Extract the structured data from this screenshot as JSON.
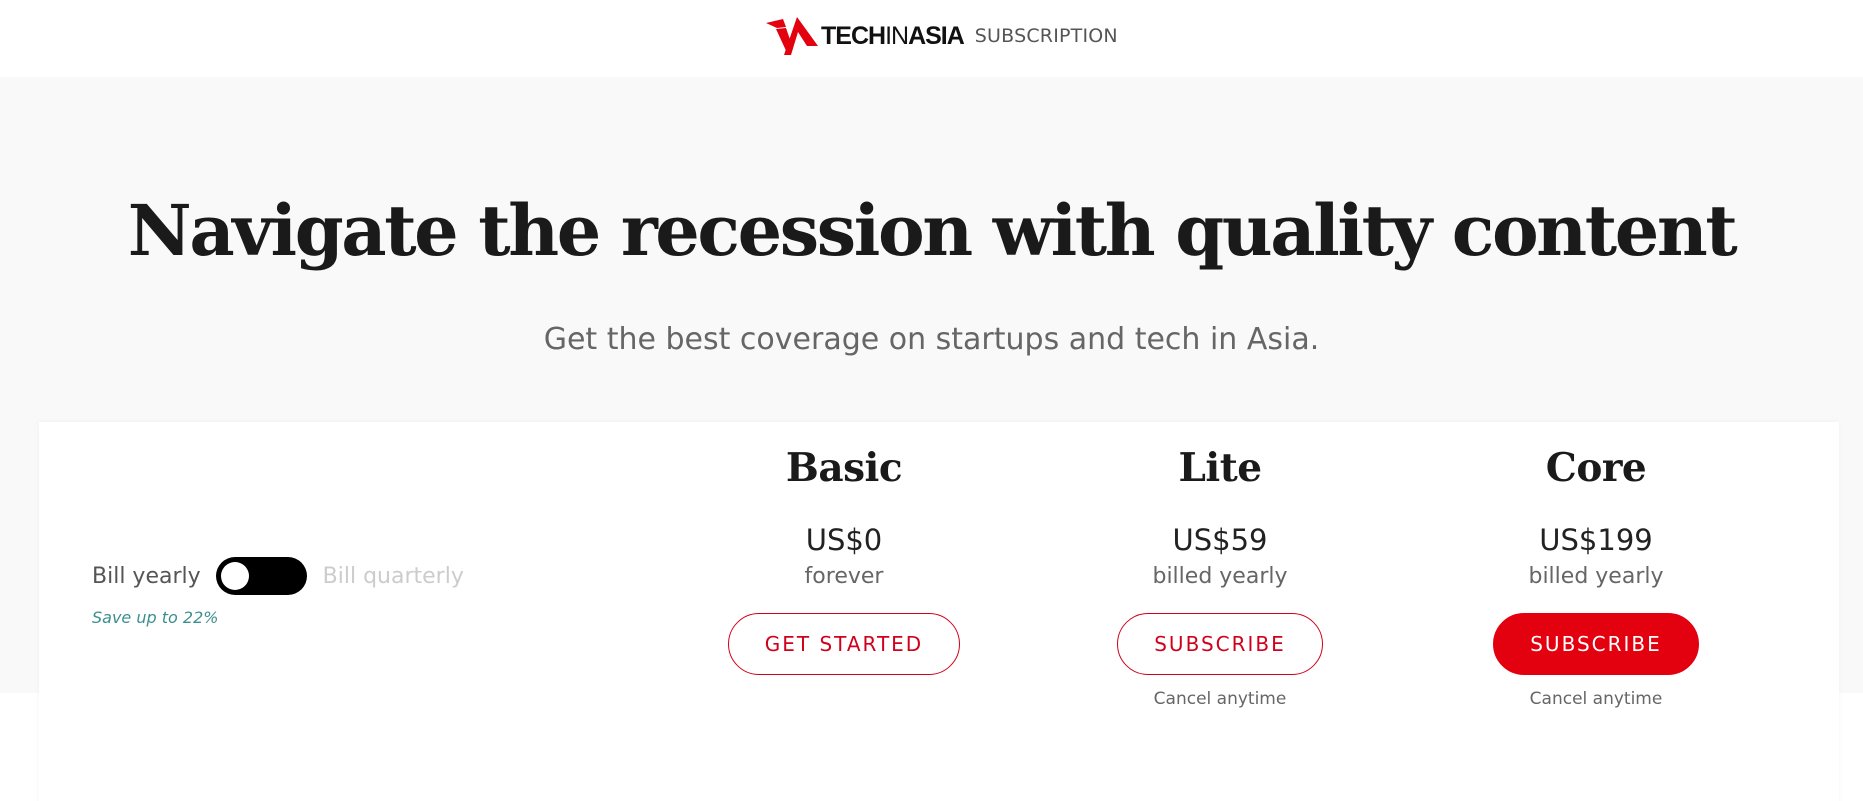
{
  "header": {
    "brand_part1": "TECH",
    "brand_part2": "IN",
    "brand_part3": "ASIA",
    "section": "SUBSCRIPTION",
    "logo_icon": "techinasia-logo-icon",
    "brand_color": "#e3000f"
  },
  "hero": {
    "title": "Navigate the recession with quality content",
    "subtitle": "Get the best coverage on startups and tech in Asia."
  },
  "billing": {
    "yearly_label": "Bill yearly",
    "quarterly_label": "Bill quarterly",
    "toggle_selected": "yearly",
    "save_note": "Save up to 22%"
  },
  "plans": [
    {
      "name": "Basic",
      "price": "US$0",
      "period": "forever",
      "button": "GET STARTED",
      "button_style": "outline",
      "cancel_note": ""
    },
    {
      "name": "Lite",
      "price": "US$59",
      "period": "billed yearly",
      "button": "SUBSCRIBE",
      "button_style": "outline",
      "cancel_note": "Cancel anytime"
    },
    {
      "name": "Core",
      "price": "US$199",
      "period": "billed yearly",
      "button": "SUBSCRIBE",
      "button_style": "filled",
      "cancel_note": "Cancel anytime"
    }
  ],
  "colors": {
    "accent_red": "#e3000f",
    "save_note_teal": "#3c8f8f",
    "hero_background": "#f9f9f9"
  }
}
